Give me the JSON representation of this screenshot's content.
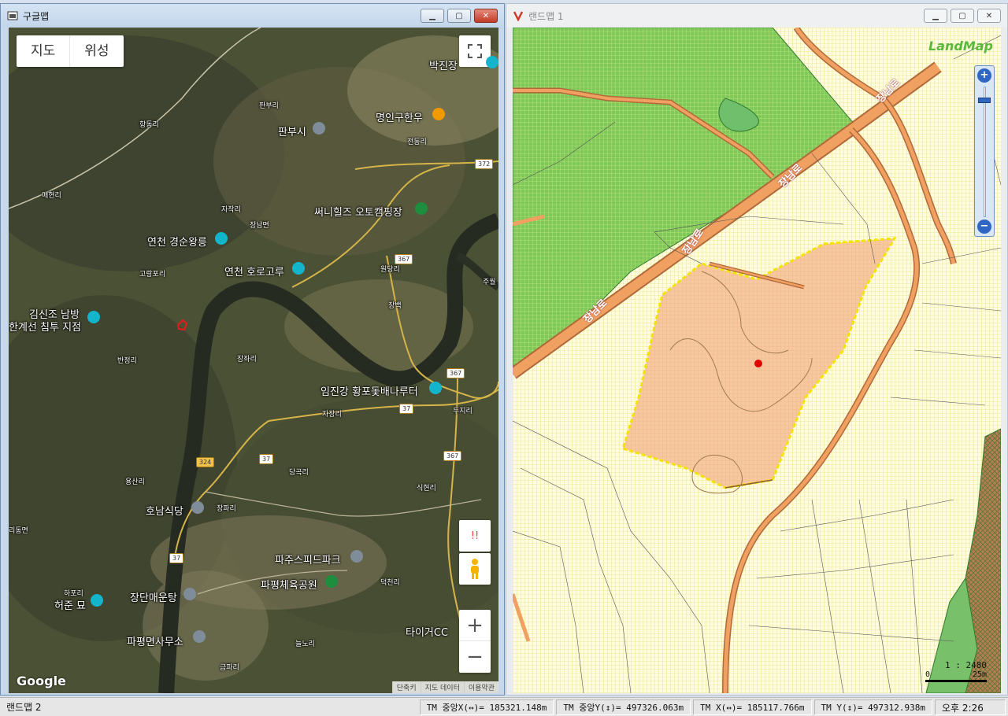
{
  "left_window": {
    "title": "구글맵",
    "controls": {
      "minimize": "▁",
      "maximize": "▢",
      "close": "✕"
    },
    "map_type": {
      "map": "지도",
      "satellite": "위성"
    },
    "labels": [
      {
        "text": "박진장",
        "size": "normal"
      },
      {
        "text": "판부리",
        "size": "small"
      },
      {
        "text": "명인구한우",
        "size": "normal"
      },
      {
        "text": "판부시",
        "size": "normal"
      },
      {
        "text": "항동리",
        "size": "small"
      },
      {
        "text": "전동리",
        "size": "small"
      },
      {
        "text": "매현리",
        "size": "small"
      },
      {
        "text": "자작리",
        "size": "small"
      },
      {
        "text": "장남면",
        "size": "small"
      },
      {
        "text": "써니힐즈 오토캠핑장",
        "size": "normal"
      },
      {
        "text": "연천 경순왕릉",
        "size": "normal"
      },
      {
        "text": "연천 호로고루",
        "size": "normal"
      },
      {
        "text": "원당리",
        "size": "small"
      },
      {
        "text": "고랑포리",
        "size": "small"
      },
      {
        "text": "주월",
        "size": "small"
      },
      {
        "text": "김신조 남방",
        "size": "normal"
      },
      {
        "text": "한계선 침투 지점",
        "size": "normal"
      },
      {
        "text": "장백",
        "size": "small"
      },
      {
        "text": "반정리",
        "size": "small"
      },
      {
        "text": "장좌리",
        "size": "small"
      },
      {
        "text": "임진강 황포돛배나루터",
        "size": "normal"
      },
      {
        "text": "자장리",
        "size": "small"
      },
      {
        "text": "두지리",
        "size": "small"
      },
      {
        "text": "당곡리",
        "size": "small"
      },
      {
        "text": "용산리",
        "size": "small"
      },
      {
        "text": "식현리",
        "size": "small"
      },
      {
        "text": "호남식당",
        "size": "normal"
      },
      {
        "text": "장파리",
        "size": "small"
      },
      {
        "text": "리동면",
        "size": "small"
      },
      {
        "text": "파주스피드파크",
        "size": "normal"
      },
      {
        "text": "파평체육공원",
        "size": "normal"
      },
      {
        "text": "덕천리",
        "size": "small"
      },
      {
        "text": "하포리",
        "size": "small"
      },
      {
        "text": "허준 묘",
        "size": "normal"
      },
      {
        "text": "장단매운탕",
        "size": "normal"
      },
      {
        "text": "타이거CC",
        "size": "normal"
      },
      {
        "text": "파평면사무소",
        "size": "normal"
      },
      {
        "text": "늘노리",
        "size": "small"
      },
      {
        "text": "금파리",
        "size": "small"
      }
    ],
    "routes": [
      "372",
      "367",
      "367",
      "37",
      "324",
      "37",
      "367",
      "37"
    ],
    "attribution": [
      "단축키",
      "지도 데이터",
      "이용약관"
    ],
    "logo": "Google",
    "zoom_in": "+",
    "zoom_out": "−",
    "alert_icon": "!!"
  },
  "right_window": {
    "title": "랜드맵 1",
    "logo": "LandMap",
    "road_labels": [
      "장남로",
      "장남로",
      "장남로",
      "장남로"
    ],
    "scale_ratio": "1 : 2480",
    "scale_zero": "0",
    "scale_length": "25m",
    "zoom_plus": "+",
    "zoom_minus": "−"
  },
  "statusbar": {
    "title": "랜드맵 2",
    "tm_center_x": "TM 중앙X(↔)= 185321.148m",
    "tm_center_y": "TM 중앙Y(↕)= 497326.063m",
    "tm_x": "TM X(↔)= 185117.766m",
    "tm_y": "TM Y(↕)= 497312.938m",
    "clock": "오후 2:26"
  },
  "colors": {
    "green_zone": "#7fc85a",
    "orange_road": "#f0a060",
    "parcel": "#f6c8a0",
    "parcel_border": "#f5e300",
    "marker": "#e30000"
  }
}
